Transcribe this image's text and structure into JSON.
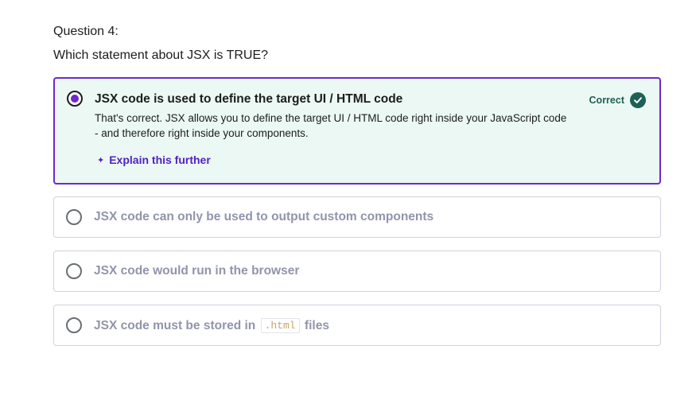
{
  "question": {
    "number_label": "Question 4:",
    "prompt": "Which statement about JSX is TRUE?"
  },
  "options": [
    {
      "label": "JSX code is used to define the target UI / HTML code",
      "selected": true,
      "status": "Correct",
      "explanation": "That's correct. JSX allows you to define the target UI / HTML code right inside your JavaScript code - and therefore right inside your components.",
      "explain_link": "Explain this further"
    },
    {
      "label": "JSX code can only be used to output custom components",
      "selected": false
    },
    {
      "label": "JSX code would run in the browser",
      "selected": false
    },
    {
      "label_before": "JSX code must be stored in",
      "label_code": ".html",
      "label_after": "files",
      "selected": false
    }
  ],
  "icons": {
    "correct": "check-circle-icon",
    "explain": "sparkle-icon"
  },
  "colors": {
    "accent": "#6d28d2",
    "correct_bg": "#ecf8f3",
    "correct_green": "#1e6055"
  }
}
